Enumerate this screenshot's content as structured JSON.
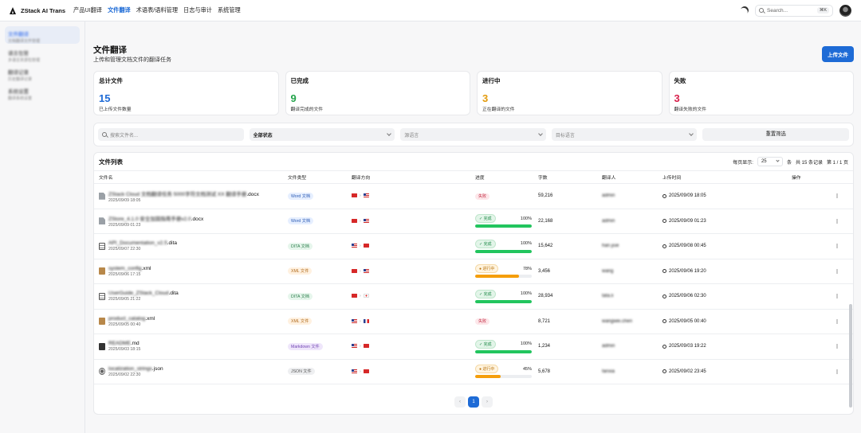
{
  "app": {
    "brand": "ZStack AI Trans"
  },
  "nav": [
    "产品UI翻译",
    "文件翻译",
    "术语表/语料管理",
    "日志与审计",
    "系统管理"
  ],
  "search": {
    "placeholder": "Search...",
    "shortcut": "⌘K"
  },
  "sidebar": {
    "items": [
      {
        "title": "文件翻译",
        "sub": "文档翻译文件管理"
      },
      {
        "title": "语言包管",
        "sub": "多语言资源包管理"
      },
      {
        "title": "翻译记录",
        "sub": "历史翻译记录"
      },
      {
        "title": "系统设置",
        "sub": "翻译系统设置"
      }
    ]
  },
  "page": {
    "title": "文件翻译",
    "subtitle": "上传和管理文档文件的翻译任务",
    "upload_label": "上传文件"
  },
  "stats": [
    {
      "label": "总计文件",
      "value": "15",
      "desc": "已上传文件数量",
      "color": "#1e6bd6"
    },
    {
      "label": "已完成",
      "value": "9",
      "desc": "翻译完成的文件",
      "color": "#22a34a"
    },
    {
      "label": "进行中",
      "value": "3",
      "desc": "正在翻译的文件",
      "color": "#e39b0c"
    },
    {
      "label": "失败",
      "value": "3",
      "desc": "翻译失败的文件",
      "color": "#d81e4a"
    }
  ],
  "filters": {
    "search_placeholder": "搜索文件名...",
    "status": "全部状态",
    "source_lang": "源语言",
    "target_lang": "目标语言",
    "reset": "重置筛选"
  },
  "table": {
    "title": "文件列表",
    "per_page_label": "每页显示:",
    "per_page_value": "25",
    "unit": "条",
    "total": "共 15 条记录",
    "page_info": "第 1 / 1 页",
    "columns": [
      "文件名",
      "文件类型",
      "翻译方向",
      "进度",
      "字数",
      "翻译人",
      "上传时间",
      "操作"
    ],
    "rows": [
      {
        "icon": "doc",
        "name_blur": "ZStack Cloud 文档翻译任务 5000字符文档测试 XX 翻译手册",
        "ext": ".docx",
        "date": "2025/09/09 18:05",
        "type": "Word 文档",
        "type_class": "b-word",
        "src": "cn",
        "tgt": "us",
        "status": "失败",
        "status_class": "s-fail",
        "pct": "",
        "words": "59,216",
        "translator": "admin",
        "uploaded": "2025/09/09 18:05"
      },
      {
        "icon": "doc",
        "name_blur": "ZStore_4.1.0 安全加固指南手册v2.0",
        "ext": ".docx",
        "date": "2025/09/09 01:23",
        "type": "Word 文档",
        "type_class": "b-word",
        "src": "cn",
        "tgt": "us",
        "status": "✓ 完成",
        "status_class": "s-done",
        "pct": "100%",
        "progress": 1.0,
        "bar": "green",
        "words": "22,168",
        "translator": "admin",
        "uploaded": "2025/09/09 01:23"
      },
      {
        "icon": "dita",
        "name_blur": "API_Documentation_v2.5",
        "ext": ".dita",
        "date": "2025/09/07 22:30",
        "type": "DITA 文档",
        "type_class": "b-dita",
        "src": "us",
        "tgt": "cn",
        "status": "✓ 完成",
        "status_class": "s-done",
        "pct": "100%",
        "progress": 1.0,
        "bar": "green",
        "words": "15,642",
        "translator": "han.yue",
        "uploaded": "2025/09/08 00:45"
      },
      {
        "icon": "xml",
        "name_blur": "system_config",
        "ext": ".xml",
        "date": "2025/09/06 17:15",
        "type": "XML 文件",
        "type_class": "b-xml",
        "src": "cn",
        "tgt": "us",
        "status": "● 进行中",
        "status_class": "s-run",
        "pct": "78%",
        "progress": 0.78,
        "bar": "amber",
        "words": "3,456",
        "translator": "wang",
        "uploaded": "2025/09/06 19:20"
      },
      {
        "icon": "dita",
        "name_blur": "UserGuide_ZStack_Cloud",
        "ext": ".dita",
        "date": "2025/09/05 21:22",
        "type": "DITA 文档",
        "type_class": "b-dita",
        "src": "cn",
        "tgt": "jp",
        "status": "✓ 完成",
        "status_class": "s-done",
        "pct": "100%",
        "progress": 1.0,
        "bar": "green",
        "words": "28,934",
        "translator": "tata.li",
        "uploaded": "2025/09/06 02:30"
      },
      {
        "icon": "xml",
        "name_blur": "product_catalog",
        "ext": ".xml",
        "date": "2025/09/05 00:40",
        "type": "XML 文件",
        "type_class": "b-xml",
        "src": "us",
        "tgt": "fr",
        "status": "失败",
        "status_class": "s-fail",
        "pct": "",
        "words": "8,721",
        "translator": "wangwei.chen",
        "uploaded": "2025/09/05 00:40"
      },
      {
        "icon": "md",
        "name_blur": "README",
        "ext": ".md",
        "date": "2025/09/03 18:15",
        "type": "Markdown 文件",
        "type_class": "b-md",
        "src": "us",
        "tgt": "cn",
        "status": "✓ 完成",
        "status_class": "s-done",
        "pct": "100%",
        "progress": 1.0,
        "bar": "green",
        "words": "1,234",
        "translator": "admin",
        "uploaded": "2025/09/03 19:22"
      },
      {
        "icon": "json",
        "name_blur": "localization_strings",
        "ext": ".json",
        "date": "2025/09/02 22:30",
        "type": "JSON 文件",
        "type_class": "b-json",
        "src": "us",
        "tgt": "cn",
        "status": "● 进行中",
        "status_class": "s-run",
        "pct": "45%",
        "progress": 0.45,
        "bar": "amber",
        "words": "5,678",
        "translator": "fanxia",
        "uploaded": "2025/09/02 23:45"
      }
    ]
  },
  "pager": {
    "prev": "‹",
    "current": "1",
    "next": "›"
  }
}
